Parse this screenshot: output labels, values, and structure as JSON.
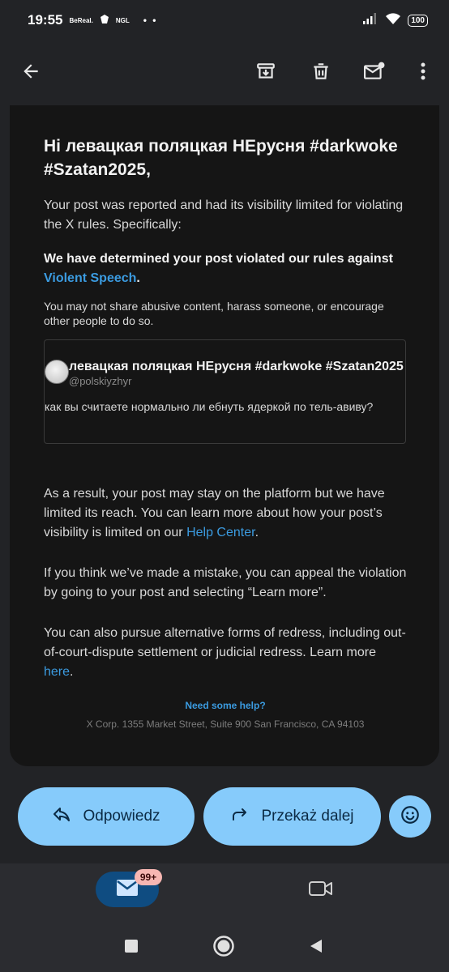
{
  "status_bar": {
    "time": "19:55",
    "notif_apps": [
      "BeReal.",
      "NGL"
    ],
    "notif_more": "• •",
    "battery": "100"
  },
  "app_bar": {
    "icons": [
      "back-arrow-icon",
      "archive-icon",
      "delete-icon",
      "mark-unread-icon",
      "more-vert-icon"
    ]
  },
  "email": {
    "greeting": "Ні левацкая поляцкая НЕрусня #darkwoke #Szatan2025,",
    "intro": "Your post was reported and had its visibility limited for violating the X rules. Specifically:",
    "violation_prefix": "We have determined your post violated our rules against",
    "violation_link": "Violent Speech",
    "violation_suffix": ".",
    "rule_text": "You may not share abusive content, harass someone, or encourage other people to do so.",
    "post": {
      "name": "левацкая поляцкая НЕрусня #darkwoke #Szatan2025",
      "handle": "@polskiyzhyr",
      "text": "как вы считаете нормально ли ебнуть ядеркой по тель-авиву?"
    },
    "result_text": "As a result, your post may stay on the platform but we have limited its reach. You can learn more about how your post’s visibility is limited on our",
    "result_link": "Help Center",
    "result_suffix": ".",
    "appeal_text": "If you think we’ve made a mistake, you can appeal the violation by going to your post and selecting “Learn more”.",
    "redress_text": "You can also pursue alternative forms of redress, including out-of-court-dispute settlement or judicial redress. Learn more",
    "redress_link": "here",
    "redress_suffix": ".",
    "help_link": "Need some help?",
    "address": "X Corp. 1355 Market Street, Suite 900 San Francisco, CA 94103"
  },
  "actions": {
    "reply_label": "Odpowiedz",
    "forward_label": "Przekaż dalej"
  },
  "bottom_nav": {
    "mail_badge": "99+"
  },
  "colors": {
    "accent_button": "#86cbfb",
    "link": "#3b9be0",
    "badge": "#f7b6b2"
  }
}
